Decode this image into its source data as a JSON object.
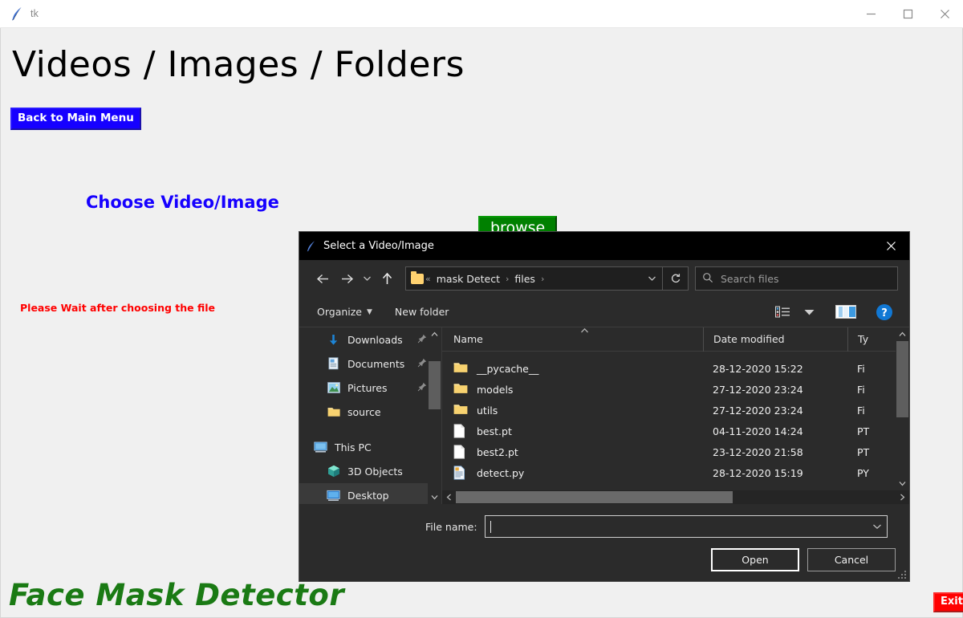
{
  "tk_window": {
    "icon": "feather-icon",
    "title": "tk",
    "minimize_label": "—",
    "maximize_label": "☐",
    "close_label": "×"
  },
  "main": {
    "page_title": "Videos / Images / Folders",
    "back_button": "Back to Main Menu",
    "choose_label": "Choose Video/Image",
    "browse_button": "browse",
    "wait_message": "Please Wait after choosing the file",
    "brand": "Face Mask Detector",
    "exit_button": "Exit"
  },
  "colors": {
    "accent_blue": "#1600ff",
    "browse_green": "#008000",
    "brand_green": "#1a7a14",
    "warning_red": "#ff0000",
    "exit_red": "#ff0000",
    "dialog_bg": "#2b2b2b",
    "dialog_titlebar": "#000000"
  },
  "dialog": {
    "icon": "feather-icon",
    "title": "Select a Video/Image",
    "close_label": "×",
    "nav": {
      "back": "←",
      "forward": "→",
      "recent": "⌄",
      "up": "↑",
      "breadcrumb_icon": "folder-icon",
      "breadcrumb_prefix": "«",
      "breadcrumbs": [
        "mask Detect",
        "files"
      ],
      "breadcrumb_sep": "›",
      "dropdown": "⌄",
      "refresh": "↻"
    },
    "search": {
      "icon": "search-icon",
      "placeholder": "Search files",
      "value": ""
    },
    "toolbar": {
      "organize": "Organize",
      "organize_caret": "▼",
      "new_folder": "New folder",
      "view_caret": "▼",
      "help_label": "?"
    },
    "tree": [
      {
        "label": "Downloads",
        "icon": "download-icon",
        "pinned": true,
        "indent": 2,
        "selected": false
      },
      {
        "label": "Documents",
        "icon": "document-icon",
        "pinned": true,
        "indent": 2,
        "selected": false
      },
      {
        "label": "Pictures",
        "icon": "picture-icon",
        "pinned": true,
        "indent": 2,
        "selected": false
      },
      {
        "label": "source",
        "icon": "folder-icon",
        "pinned": false,
        "indent": 2,
        "selected": false
      },
      {
        "label": "",
        "icon": "",
        "pinned": false,
        "indent": 1,
        "selected": false
      },
      {
        "label": "This PC",
        "icon": "pc-icon",
        "pinned": false,
        "indent": 1,
        "selected": false
      },
      {
        "label": "3D Objects",
        "icon": "cube-icon",
        "pinned": false,
        "indent": 2,
        "selected": false
      },
      {
        "label": "Desktop",
        "icon": "desktop-icon",
        "pinned": false,
        "indent": 2,
        "selected": true
      }
    ],
    "list": {
      "columns": [
        "Name",
        "Date modified",
        "Ty"
      ],
      "sort_indicator": "⌃",
      "rows": [
        {
          "name": "__pycache__",
          "icon": "folder-icon",
          "date": "28-12-2020 15:22",
          "type": "Fi"
        },
        {
          "name": "models",
          "icon": "folder-icon",
          "date": "27-12-2020 23:24",
          "type": "Fi"
        },
        {
          "name": "utils",
          "icon": "folder-icon",
          "date": "27-12-2020 23:24",
          "type": "Fi"
        },
        {
          "name": "best.pt",
          "icon": "file-icon",
          "date": "04-11-2020 14:24",
          "type": "PT"
        },
        {
          "name": "best2.pt",
          "icon": "file-icon",
          "date": "23-12-2020 21:58",
          "type": "PT"
        },
        {
          "name": "detect.py",
          "icon": "python-file-icon",
          "date": "28-12-2020 15:19",
          "type": "PY"
        }
      ]
    },
    "file_name": {
      "label": "File name:",
      "value": "",
      "dropdown": "⌄"
    },
    "buttons": {
      "open": "Open",
      "cancel": "Cancel"
    }
  }
}
